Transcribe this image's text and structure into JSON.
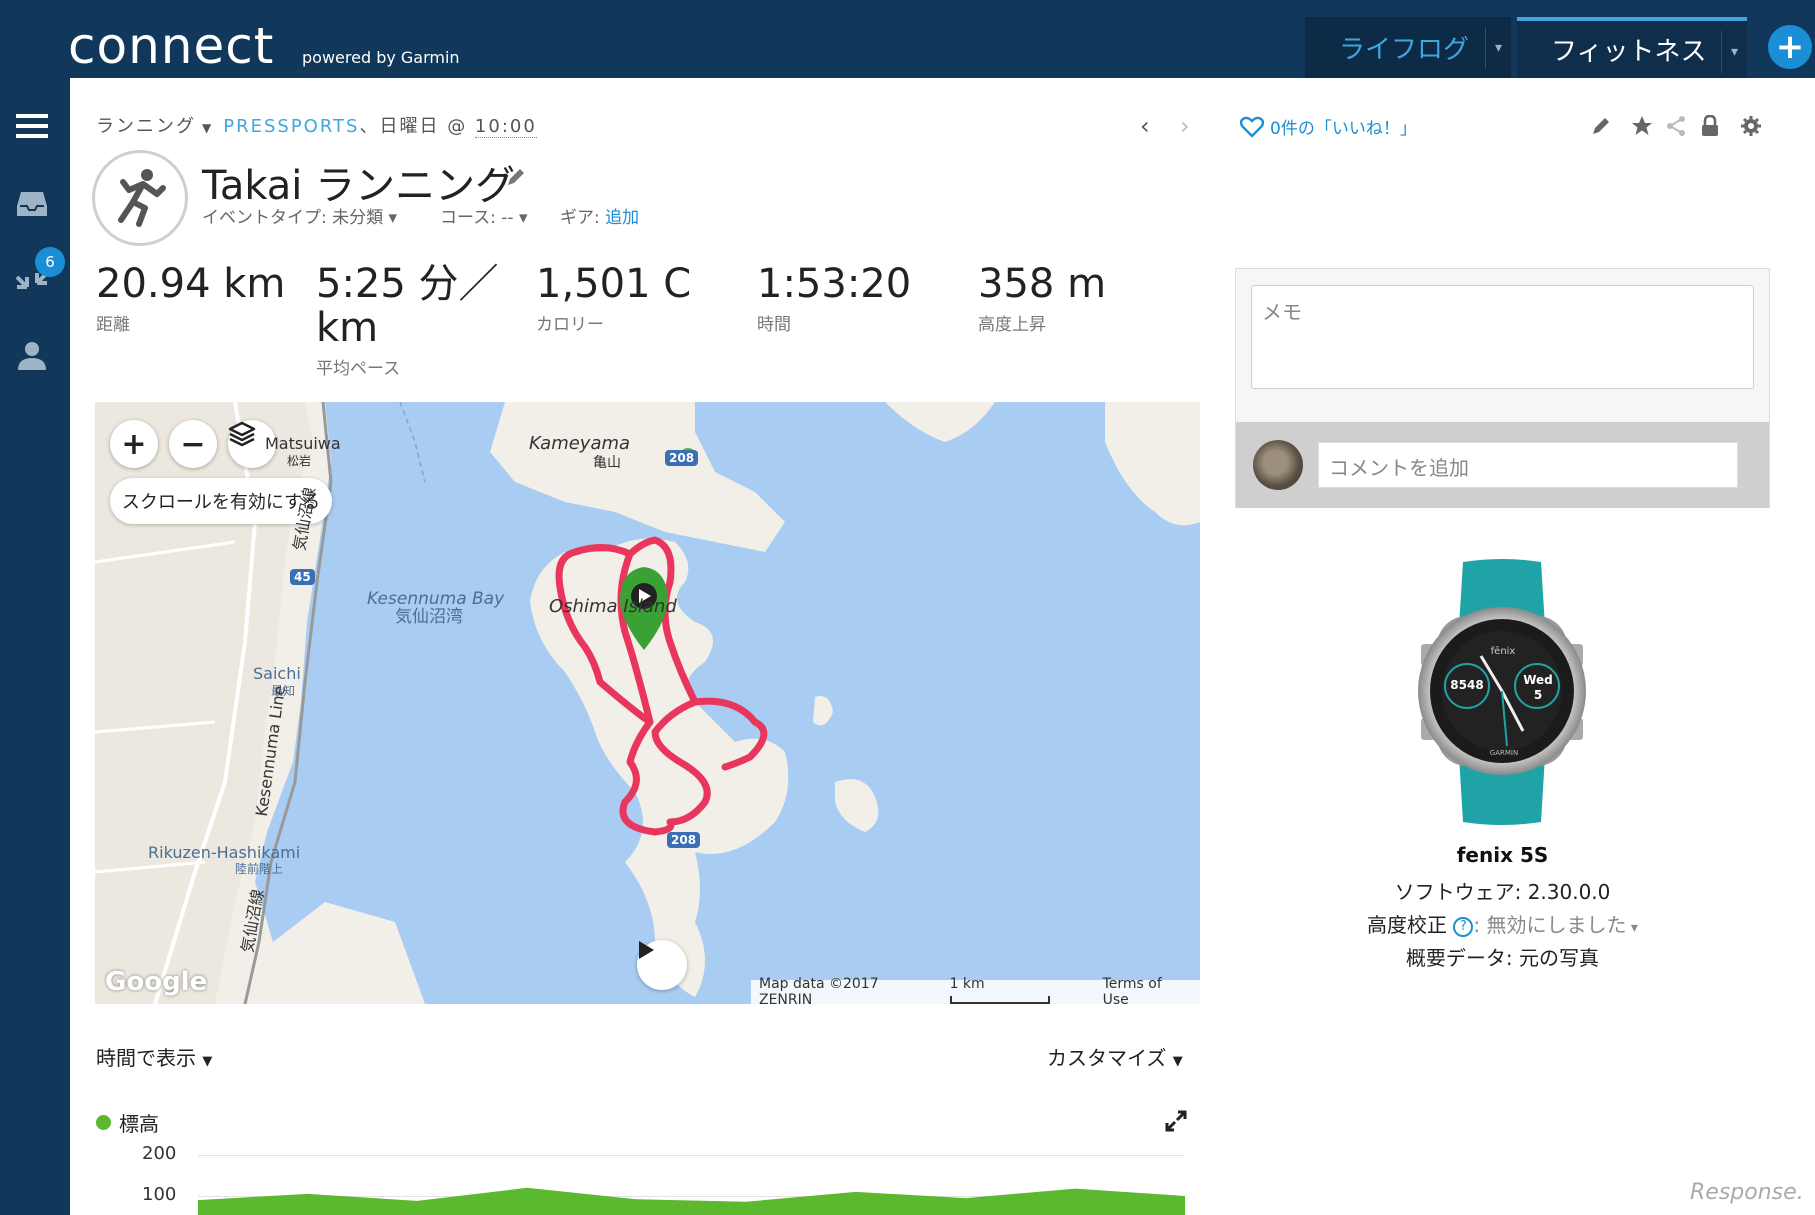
{
  "header": {
    "logo": "connect",
    "powered_by": "powered by Garmin",
    "tabs": [
      {
        "label": "ライフログ"
      },
      {
        "label": "フィットネス"
      }
    ],
    "add_label": "+"
  },
  "sidebar": {
    "badge_count": "6",
    "icons": [
      "menu-icon",
      "inbox-icon",
      "connections-icon",
      "profile-icon"
    ]
  },
  "activity": {
    "type_label": "ランニング",
    "source": "PRESSPORTS",
    "day": "、日曜日 @ ",
    "time": "10:00",
    "title": "Takai ランニング",
    "event_type": "イベントタイプ: 未分類",
    "course": "コース: --",
    "gear_label": "ギア: ",
    "gear_link": "追加"
  },
  "stats": [
    {
      "value": "20.94 km",
      "label": "距離"
    },
    {
      "value": "5:25 分／km",
      "label": "平均ペース"
    },
    {
      "value": "1,501 C",
      "label": "カロリー"
    },
    {
      "value": "1:53:20",
      "label": "時間"
    },
    {
      "value": "358 m",
      "label": "高度上昇"
    }
  ],
  "social": {
    "likes": "0件の「いいね！」",
    "memo_placeholder": "メモ",
    "comment_placeholder": "コメントを追加"
  },
  "device": {
    "name": "fenix 5S",
    "face_brand": "fēnix",
    "face_steps": "8548",
    "face_day": "Wed",
    "face_date": "5",
    "face_maker": "GARMIN",
    "software": "ソフトウェア: 2.30.0.0",
    "altitude_label": "高度校正 ",
    "altitude_value": ": 無効にしました",
    "summary": "概要データ: 元の写真"
  },
  "map": {
    "scroll_label": "スクロールを有効にする",
    "attribution": "Map data ©2017 ZENRIN",
    "scale": "1 km",
    "terms": "Terms of Use",
    "google": "Google",
    "labels": {
      "kameyama": "Kameyama",
      "kameyama_jp": "亀山",
      "bay": "Kesennuma Bay",
      "bay_jp": "気仙沼湾",
      "oshima": "Oshima Island",
      "saichi": "Saichi",
      "saichi_jp": "最知",
      "matsuiwa": "Matsuiwa",
      "matsuiwa_jp": "松岩",
      "rikuzen": "Rikuzen-Hashikami",
      "rikuzen_jp": "陸前階上",
      "line": "Kesennuma Line",
      "line_jp1": "気仙沼線",
      "line_jp2": "気仙沼線",
      "route45": "45",
      "route208": "208",
      "route208b": "208"
    }
  },
  "chart": {
    "show_by": "時間で表示",
    "customize": "カスタマイズ",
    "legend": "標高",
    "y_ticks": [
      "200",
      "100"
    ]
  },
  "chart_data": {
    "type": "area",
    "title": "",
    "series": [
      {
        "name": "標高",
        "values": [
          90,
          105,
          88,
          120,
          92,
          86,
          110,
          95,
          118,
          100
        ]
      }
    ],
    "y_ticks": [
      200,
      100
    ],
    "color": "#5cb82e"
  },
  "watermark": "Response.",
  "colors": {
    "nav": "#11385a",
    "accent": "#1a8fd6",
    "route": "#e8365d",
    "water": "#a8ccf2",
    "land": "#f2efe8",
    "elevation": "#5cb82e"
  }
}
